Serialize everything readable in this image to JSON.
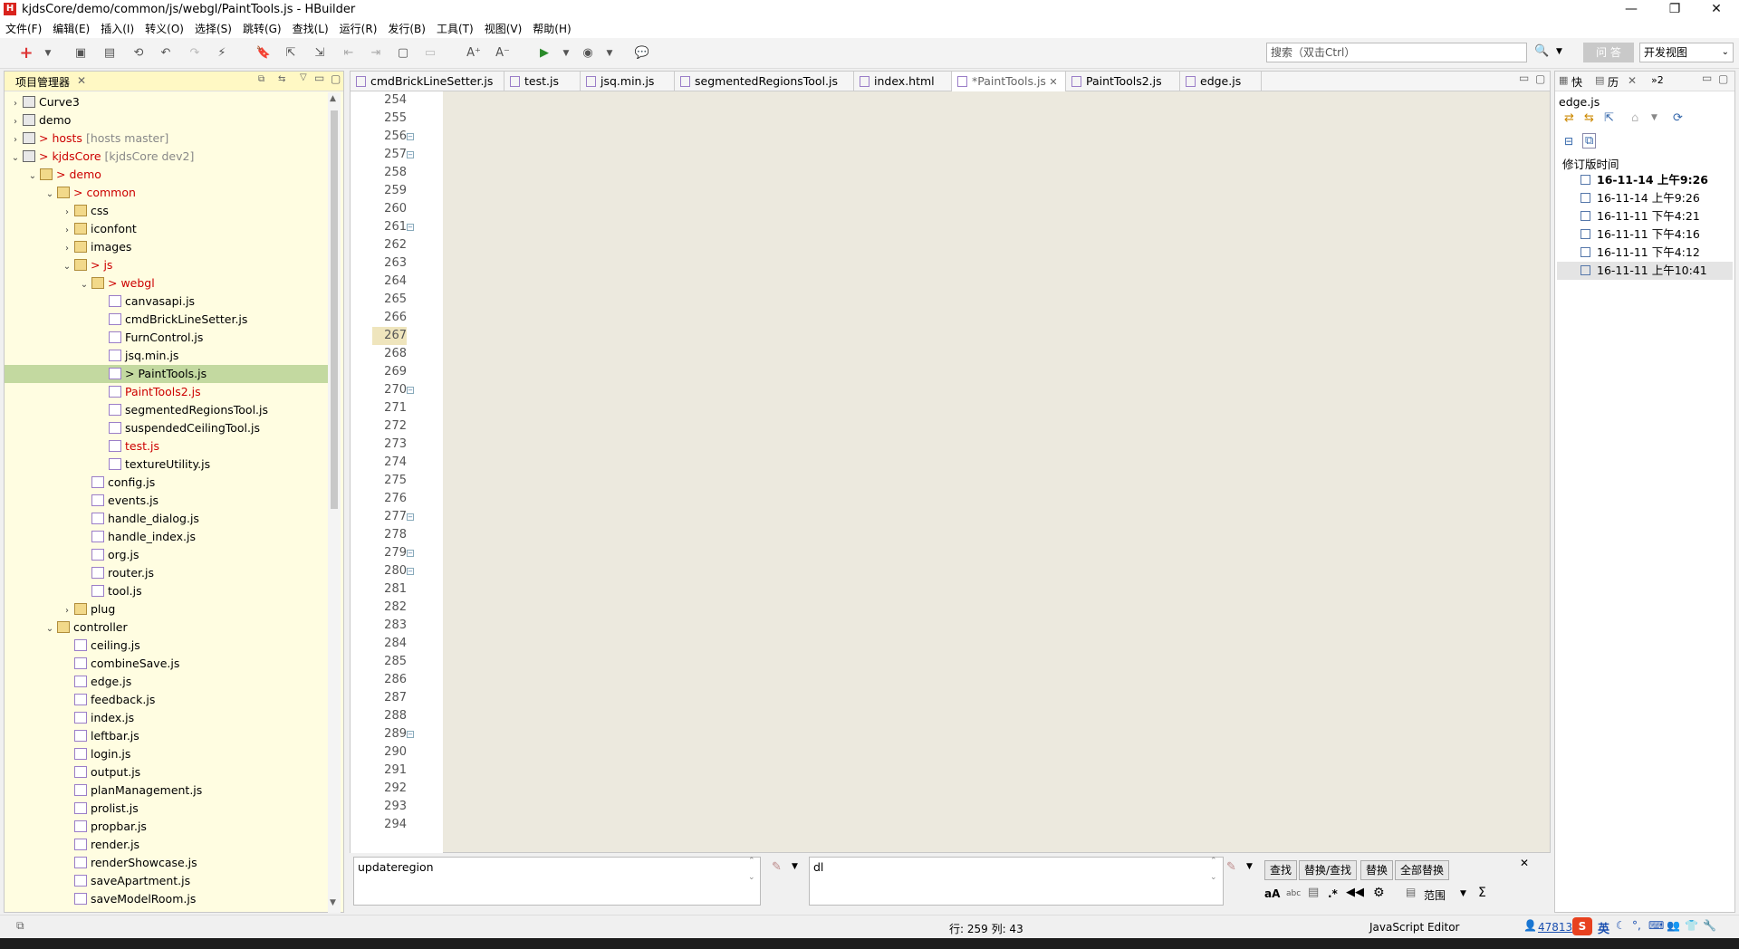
{
  "window": {
    "title": "kjdsCore/demo/common/js/webgl/PaintTools.js  -  HBuilder",
    "logo": "H",
    "minimize": "—",
    "restore": "❐",
    "close": "✕"
  },
  "menu": [
    "文件(F)",
    "编辑(E)",
    "插入(I)",
    "转义(O)",
    "选择(S)",
    "跳转(G)",
    "查找(L)",
    "运行(R)",
    "发行(B)",
    "工具(T)",
    "视图(V)",
    "帮助(H)"
  ],
  "toolbar": {
    "search_placeholder": "搜索（双击Ctrl）",
    "ask_label": "问 答",
    "view_select": "开发视图"
  },
  "project_panel": {
    "title": "项目管理器",
    "tree": [
      {
        "label": "Curve3",
        "depth": 0,
        "arrow": "›",
        "icon": "proj"
      },
      {
        "label": "demo",
        "depth": 0,
        "arrow": "›",
        "icon": "proj"
      },
      {
        "label": "> hosts",
        "extra": "[hosts master]",
        "depth": 0,
        "arrow": "›",
        "icon": "proj",
        "red": true
      },
      {
        "label": "> kjdsCore",
        "extra": "[kjdsCore dev2]",
        "depth": 0,
        "arrow": "⌄",
        "icon": "proj",
        "red": true
      },
      {
        "label": "> demo",
        "depth": 1,
        "arrow": "⌄",
        "icon": "folder",
        "red": true
      },
      {
        "label": "> common",
        "depth": 2,
        "arrow": "⌄",
        "icon": "folder",
        "red": true
      },
      {
        "label": "css",
        "depth": 3,
        "arrow": "›",
        "icon": "folder"
      },
      {
        "label": "iconfont",
        "depth": 3,
        "arrow": "›",
        "icon": "folder"
      },
      {
        "label": "images",
        "depth": 3,
        "arrow": "›",
        "icon": "folder"
      },
      {
        "label": "> js",
        "depth": 3,
        "arrow": "⌄",
        "icon": "folder",
        "red": true
      },
      {
        "label": "> webgl",
        "depth": 4,
        "arrow": "⌄",
        "icon": "folder",
        "red": true
      },
      {
        "label": "canvasapi.js",
        "depth": 5,
        "arrow": "",
        "icon": "file"
      },
      {
        "label": "cmdBrickLineSetter.js",
        "depth": 5,
        "arrow": "",
        "icon": "file"
      },
      {
        "label": "FurnControl.js",
        "depth": 5,
        "arrow": "",
        "icon": "file"
      },
      {
        "label": "jsq.min.js",
        "depth": 5,
        "arrow": "",
        "icon": "file"
      },
      {
        "label": "> PaintTools.js",
        "depth": 5,
        "arrow": "",
        "icon": "file",
        "selected": true
      },
      {
        "label": "PaintTools2.js",
        "depth": 5,
        "arrow": "",
        "icon": "file",
        "red": true
      },
      {
        "label": "segmentedRegionsTool.js",
        "depth": 5,
        "arrow": "",
        "icon": "file"
      },
      {
        "label": "suspendedCeilingTool.js",
        "depth": 5,
        "arrow": "",
        "icon": "file"
      },
      {
        "label": "test.js",
        "depth": 5,
        "arrow": "",
        "icon": "file",
        "red": true
      },
      {
        "label": "textureUtility.js",
        "depth": 5,
        "arrow": "",
        "icon": "file"
      },
      {
        "label": "config.js",
        "depth": 4,
        "arrow": "",
        "icon": "file"
      },
      {
        "label": "events.js",
        "depth": 4,
        "arrow": "",
        "icon": "file"
      },
      {
        "label": "handle_dialog.js",
        "depth": 4,
        "arrow": "",
        "icon": "file"
      },
      {
        "label": "handle_index.js",
        "depth": 4,
        "arrow": "",
        "icon": "file"
      },
      {
        "label": "org.js",
        "depth": 4,
        "arrow": "",
        "icon": "file"
      },
      {
        "label": "router.js",
        "depth": 4,
        "arrow": "",
        "icon": "file"
      },
      {
        "label": "tool.js",
        "depth": 4,
        "arrow": "",
        "icon": "file"
      },
      {
        "label": "plug",
        "depth": 3,
        "arrow": "›",
        "icon": "folder"
      },
      {
        "label": "controller",
        "depth": 2,
        "arrow": "⌄",
        "icon": "folder"
      },
      {
        "label": "ceiling.js",
        "depth": 3,
        "arrow": "",
        "icon": "file"
      },
      {
        "label": "combineSave.js",
        "depth": 3,
        "arrow": "",
        "icon": "file"
      },
      {
        "label": "edge.js",
        "depth": 3,
        "arrow": "",
        "icon": "file"
      },
      {
        "label": "feedback.js",
        "depth": 3,
        "arrow": "",
        "icon": "file"
      },
      {
        "label": "index.js",
        "depth": 3,
        "arrow": "",
        "icon": "file"
      },
      {
        "label": "leftbar.js",
        "depth": 3,
        "arrow": "",
        "icon": "file"
      },
      {
        "label": "login.js",
        "depth": 3,
        "arrow": "",
        "icon": "file"
      },
      {
        "label": "output.js",
        "depth": 3,
        "arrow": "",
        "icon": "file"
      },
      {
        "label": "planManagement.js",
        "depth": 3,
        "arrow": "",
        "icon": "file"
      },
      {
        "label": "prolist.js",
        "depth": 3,
        "arrow": "",
        "icon": "file"
      },
      {
        "label": "propbar.js",
        "depth": 3,
        "arrow": "",
        "icon": "file"
      },
      {
        "label": "render.js",
        "depth": 3,
        "arrow": "",
        "icon": "file"
      },
      {
        "label": "renderShowcase.js",
        "depth": 3,
        "arrow": "",
        "icon": "file"
      },
      {
        "label": "saveApartment.js",
        "depth": 3,
        "arrow": "",
        "icon": "file"
      },
      {
        "label": "saveModelRoom.js",
        "depth": 3,
        "arrow": "",
        "icon": "file"
      }
    ]
  },
  "editor": {
    "tabs": [
      {
        "label": "cmdBrickLineSetter.js",
        "active": false
      },
      {
        "label": "test.js",
        "active": false
      },
      {
        "label": "jsq.min.js",
        "active": false
      },
      {
        "label": "segmentedRegionsTool.js",
        "active": false
      },
      {
        "label": "index.html",
        "active": false
      },
      {
        "label": "*PaintTools.js",
        "active": true,
        "closable": true
      },
      {
        "label": "PaintTools2.js",
        "active": false
      },
      {
        "label": "edge.js",
        "active": false
      }
    ],
    "line_numbers": [
      254,
      255,
      256,
      257,
      258,
      259,
      260,
      261,
      262,
      263,
      264,
      265,
      266,
      267,
      268,
      269,
      270,
      271,
      272,
      273,
      274,
      275,
      276,
      277,
      278,
      279,
      280,
      281,
      282,
      283,
      284,
      285,
      286,
      287,
      288,
      289,
      290,
      291,
      292,
      293,
      294
    ],
    "fold_lines": [
      256,
      257,
      261,
      270,
      277,
      279,
      280,
      289
    ],
    "current_line": 267
  },
  "find_bar": {
    "find_value": "updateregion",
    "replace_value": "dl",
    "find_btn": "查找",
    "replace_find_btn": "替换/查找",
    "replace_btn": "替换",
    "replace_all_btn": "全部替换",
    "case_label": "aA",
    "word_label": "abc",
    "regex_label": ".*",
    "scope_label": "范围",
    "sigma_label": "Σ"
  },
  "history_panel": {
    "tab_quick": "快",
    "tab_history": "历",
    "tab_more": "»2",
    "file": "edge.js",
    "column_header": "修订版时间",
    "revisions": [
      {
        "time": "16-11-14 上午9:26",
        "bold": true
      },
      {
        "time": "16-11-14 上午9:26",
        "bold": false
      },
      {
        "time": "16-11-11 下午4:21",
        "bold": false
      },
      {
        "time": "16-11-11 下午4:16",
        "bold": false
      },
      {
        "time": "16-11-11 下午4:12",
        "bold": false
      },
      {
        "time": "16-11-11 上午10:41",
        "bold": false,
        "selected": true
      }
    ]
  },
  "status": {
    "position": "行: 259 列: 43",
    "editor_type": "JavaScript Editor",
    "user_count": "47813",
    "ime": "英"
  }
}
